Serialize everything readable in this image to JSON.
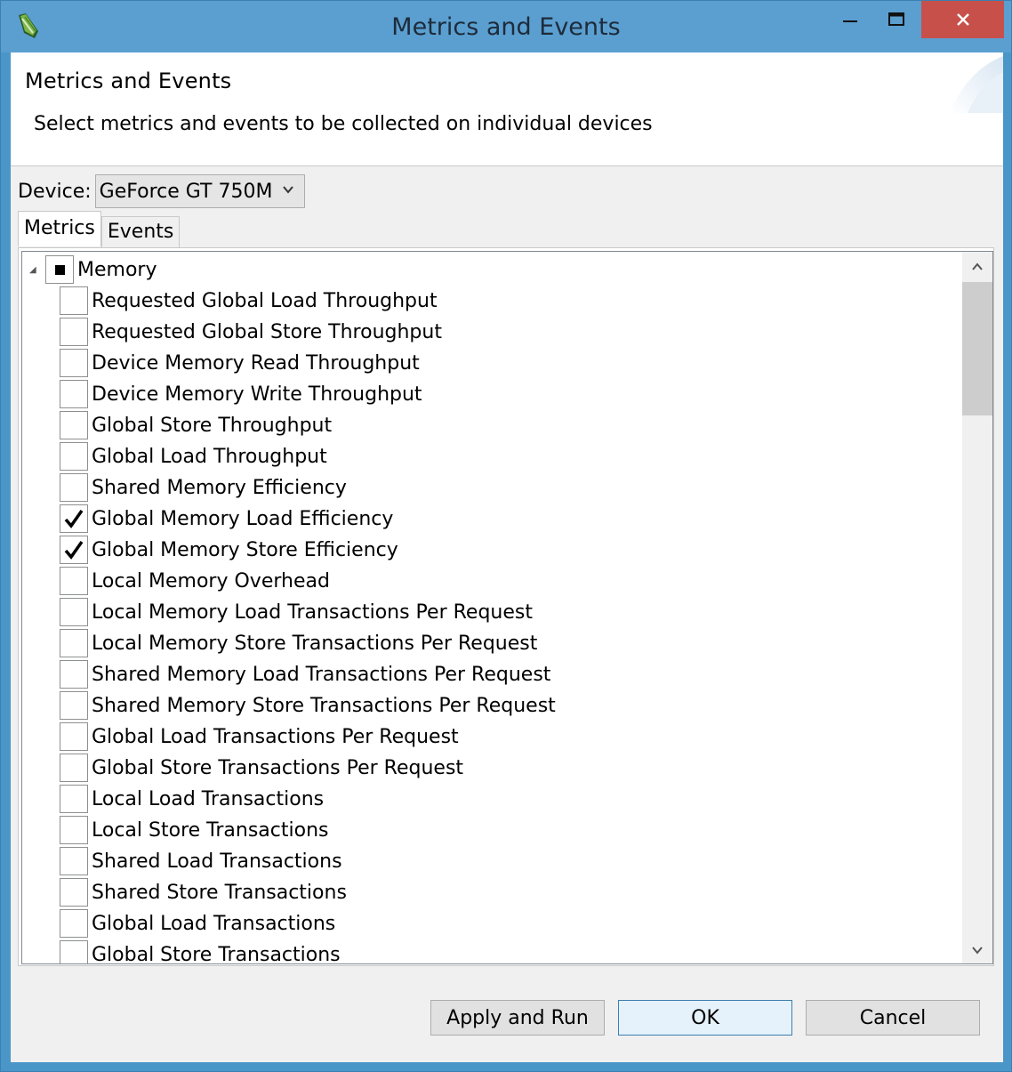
{
  "window": {
    "title": "Metrics and Events"
  },
  "banner": {
    "title": "Metrics and Events",
    "message": "Select metrics and events to be collected on individual devices"
  },
  "device": {
    "label": "Device:",
    "selected": "GeForce GT 750M"
  },
  "tabs": [
    {
      "label": "Metrics",
      "active": true
    },
    {
      "label": "Events",
      "active": false
    }
  ],
  "tree": {
    "root": {
      "label": "Memory",
      "state": "partial",
      "expanded": true
    },
    "items": [
      {
        "label": "Requested Global Load Throughput",
        "checked": false
      },
      {
        "label": "Requested Global Store Throughput",
        "checked": false
      },
      {
        "label": "Device Memory Read Throughput",
        "checked": false
      },
      {
        "label": "Device Memory Write Throughput",
        "checked": false
      },
      {
        "label": "Global Store Throughput",
        "checked": false
      },
      {
        "label": "Global Load Throughput",
        "checked": false
      },
      {
        "label": "Shared Memory Efficiency",
        "checked": false
      },
      {
        "label": "Global Memory Load Efficiency",
        "checked": true
      },
      {
        "label": "Global Memory Store Efficiency",
        "checked": true
      },
      {
        "label": "Local Memory Overhead",
        "checked": false
      },
      {
        "label": "Local Memory Load Transactions Per Request",
        "checked": false
      },
      {
        "label": "Local Memory Store Transactions Per Request",
        "checked": false
      },
      {
        "label": "Shared Memory Load Transactions Per Request",
        "checked": false
      },
      {
        "label": "Shared Memory Store Transactions Per Request",
        "checked": false
      },
      {
        "label": "Global Load Transactions Per Request",
        "checked": false
      },
      {
        "label": "Global Store Transactions Per Request",
        "checked": false
      },
      {
        "label": "Local Load Transactions",
        "checked": false
      },
      {
        "label": "Local Store Transactions",
        "checked": false
      },
      {
        "label": "Shared Load Transactions",
        "checked": false
      },
      {
        "label": "Shared Store Transactions",
        "checked": false
      },
      {
        "label": "Global Load Transactions",
        "checked": false
      },
      {
        "label": "Global Store Transactions",
        "checked": false
      }
    ]
  },
  "buttons": {
    "apply_run": "Apply and Run",
    "ok": "OK",
    "cancel": "Cancel"
  },
  "colors": {
    "title_bar": "#5a9fd0",
    "close_button": "#c7504b",
    "dialog_bg": "#f0f0f0"
  }
}
